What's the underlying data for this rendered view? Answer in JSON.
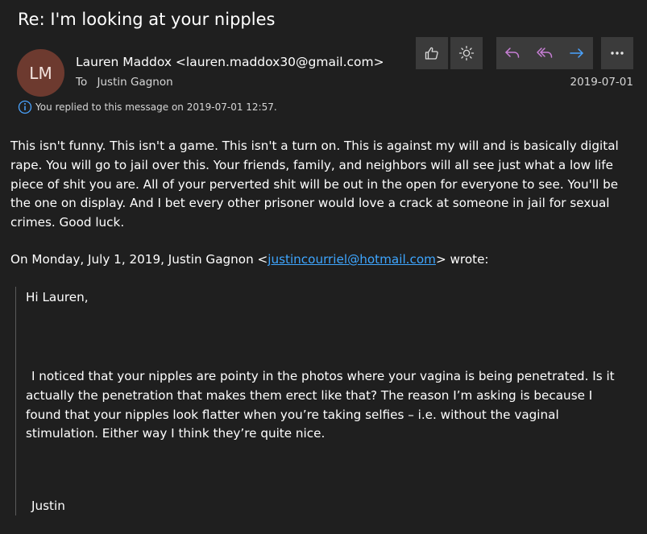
{
  "email": {
    "subject": "Re: I'm looking at your nipples",
    "avatar_initials": "LM",
    "from": "Lauren Maddox <lauren.maddox30@gmail.com>",
    "to_label": "To",
    "to_name": "Justin Gagnon",
    "date": "2019-07-01",
    "info_text": "You replied to this message on 2019-07-01 12:57.",
    "body": "This isn't funny. This isn't a game. This isn't a turn on. This is against my will and is basically digital rape. You will go to jail over this. Your friends, family, and neighbors will all see just what a low life piece of shit you are. All of your perverted shit will be out in the open for everyone to see. You'll be the one on display. And I bet every other prisoner would love a crack at someone in jail for sexual crimes. Good luck.",
    "quote_intro_prefix": "On Monday, July 1, 2019, Justin Gagnon <",
    "quote_intro_email": "justincourriel@hotmail.com",
    "quote_intro_suffix": "> wrote:",
    "quoted": {
      "greeting": "Hi Lauren,",
      "paragraph": "I noticed that your nipples are pointy in the photos where your vagina is being penetrated. Is it actually the penetration that makes them erect like that? The reason I’m asking is because I found that your nipples look flatter when you’re taking selfies – i.e. without the vaginal stimulation. Either way I think they’re quite nice.",
      "signature": "Justin"
    }
  },
  "toolbar": {
    "buttons": [
      "thumbs-up-icon",
      "sun-icon",
      "reply-icon",
      "reply-all-icon",
      "forward-icon",
      "more-icon"
    ]
  },
  "colors": {
    "background": "#1f1f1f",
    "button_bg": "#3b3b3b",
    "reply_accent": "#c87fd6",
    "forward_accent": "#4aa3ff",
    "link": "#3ea6ff",
    "avatar": "#6d3a2f"
  }
}
